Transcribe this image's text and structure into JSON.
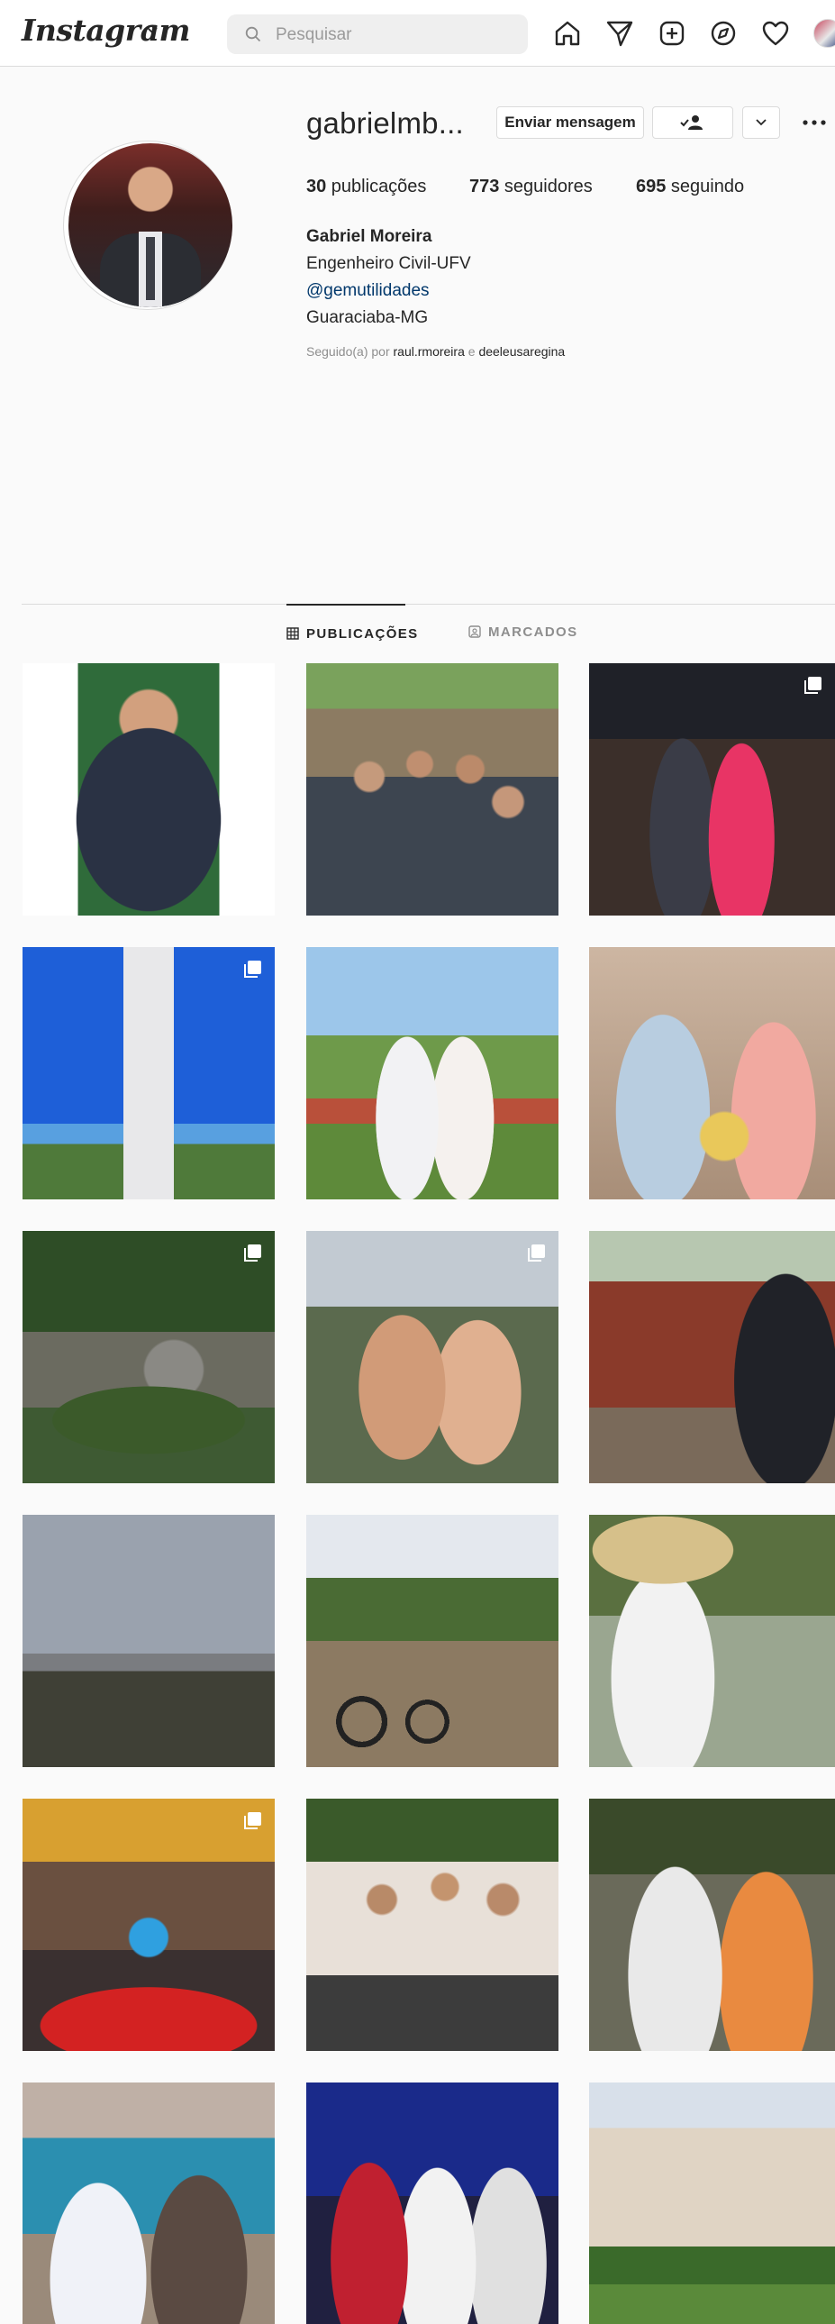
{
  "nav": {
    "logo": "Instagram",
    "search_placeholder": "Pesquisar",
    "icons": [
      "home-icon",
      "direct-icon",
      "new-post-icon",
      "explore-icon",
      "activity-icon",
      "profile-avatar"
    ]
  },
  "profile": {
    "username": "gabrielmb...",
    "message_button": "Enviar mensagem",
    "stats": {
      "posts_count": "30",
      "posts_label": " publicações",
      "followers_count": "773",
      "followers_label": " seguidores",
      "following_count": "695",
      "following_label": " seguindo"
    },
    "full_name": "Gabriel Moreira",
    "bio_line1": "Engenheiro Civil-UFV",
    "bio_link": "@gemutilidades",
    "bio_line3": "Guaraciaba-MG",
    "followed_prefix": "Seguido(a) por ",
    "followed_user1": "raul.rmoreira",
    "followed_sep": " e ",
    "followed_user2": "deeleusaregina"
  },
  "tabs": {
    "posts": "PUBLICAÇÕES",
    "tagged": "MARCADOS"
  },
  "colors": {
    "background": "#fafafa",
    "link": "#00376b",
    "text": "#262626",
    "muted": "#8e8e8e",
    "border": "#dbdbdb"
  },
  "grid": {
    "posts": [
      {
        "name": "post-portrait-praia-shirt",
        "multi": false
      },
      {
        "name": "post-group-friends-outdoors",
        "multi": false
      },
      {
        "name": "post-couple-formal-event",
        "multi": true
      },
      {
        "name": "post-lighthouse-tower",
        "multi": true
      },
      {
        "name": "post-couple-palm-tree",
        "multi": false
      },
      {
        "name": "post-couple-birthday-cake",
        "multi": false
      },
      {
        "name": "post-river-rocks",
        "multi": true
      },
      {
        "name": "post-couple-selfie-mountain",
        "multi": true
      },
      {
        "name": "post-coffee-drying",
        "multi": false
      },
      {
        "name": "post-sunset-landscape",
        "multi": false
      },
      {
        "name": "post-bicycle-landscape",
        "multi": false
      },
      {
        "name": "post-woman-straw-hat",
        "multi": false
      },
      {
        "name": "post-group-bar",
        "multi": true
      },
      {
        "name": "post-group-floral-shirts",
        "multi": false
      },
      {
        "name": "post-couple-sunglasses",
        "multi": false
      },
      {
        "name": "post-couple-beach",
        "multi": false
      },
      {
        "name": "post-friends-concert",
        "multi": false
      },
      {
        "name": "post-university-building",
        "multi": false
      }
    ]
  }
}
